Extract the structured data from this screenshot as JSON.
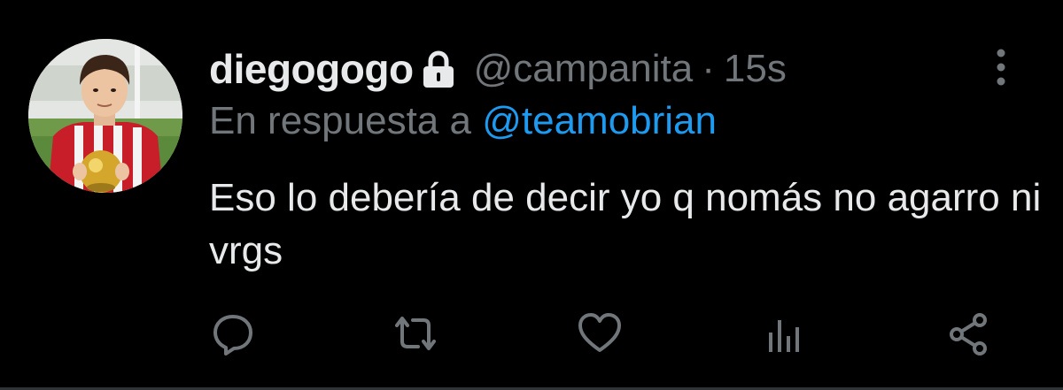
{
  "tweet": {
    "display_name": "diegogogo",
    "handle": "@campanita",
    "separator": "·",
    "timestamp": "15s",
    "reply_prefix": "En respuesta a",
    "reply_to": "@teamobrian",
    "text": "Eso lo debería de decir yo q nomás no agarro ni vrgs",
    "protected": true
  },
  "icons": {
    "lock": "lock-icon",
    "more": "more-vertical-icon",
    "reply": "reply-icon",
    "retweet": "retweet-icon",
    "like": "heart-icon",
    "analytics": "analytics-icon",
    "share": "share-icon"
  },
  "colors": {
    "background": "#000000",
    "primary_text": "#e7e9ea",
    "secondary_text": "#71767b",
    "link": "#1d9bf0"
  }
}
